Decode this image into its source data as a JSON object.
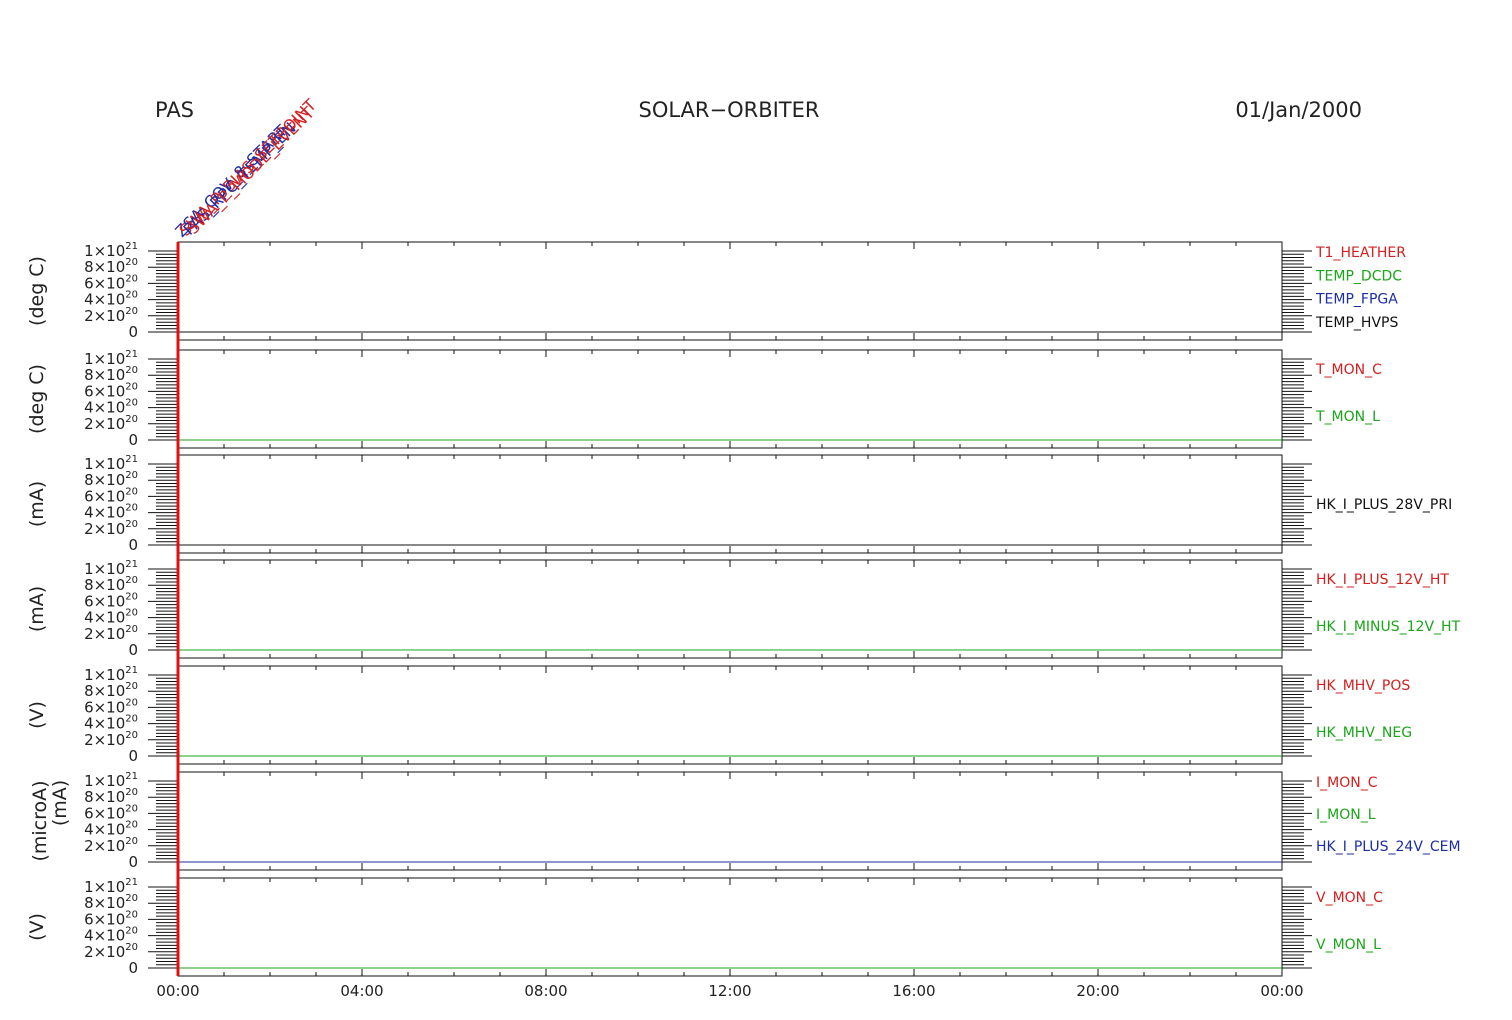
{
  "header": {
    "left": "PAS",
    "center": "SOLAR−ORBITER",
    "right": "01/Jan/2000"
  },
  "colors": {
    "red": "#d42020",
    "green": "#1aa51a",
    "blue": "#1c2ea6",
    "black": "#111111",
    "marker": "#e01010"
  },
  "chart_data": {
    "type": "line",
    "x_range": [
      "00:00",
      "24:00"
    ],
    "x_tick_labels": [
      "00:00",
      "04:00",
      "08:00",
      "12:00",
      "16:00",
      "20:00",
      "00:00"
    ],
    "marker_time": "00:00",
    "event_labels": [
      {
        "text": "ZSA_COV_8_START",
        "color": "blue"
      },
      {
        "text": "SWA_P_BIAS_SETPOINT",
        "color": "red"
      },
      {
        "text": "PAS_RPC_TEMP_EN",
        "color": "blue"
      },
      {
        "text": "SWA_P_MODE_EVENT",
        "color": "red"
      }
    ],
    "panels": [
      {
        "ylabel": "(deg C)",
        "ylim": [
          0,
          1e+21
        ],
        "y_ticks": [
          {
            "m": "0",
            "e": ""
          },
          {
            "m": "2×10",
            "e": "20"
          },
          {
            "m": "4×10",
            "e": "20"
          },
          {
            "m": "6×10",
            "e": "20"
          },
          {
            "m": "8×10",
            "e": "20"
          },
          {
            "m": "1×10",
            "e": "21"
          }
        ],
        "series": [
          {
            "name": "T1_HEATHER",
            "color": "red",
            "values": [
              0,
              0
            ]
          },
          {
            "name": "TEMP_DCDC",
            "color": "green",
            "values": [
              0,
              0
            ]
          },
          {
            "name": "TEMP_FPGA",
            "color": "blue",
            "values": [
              0,
              0
            ]
          },
          {
            "name": "TEMP_HVPS",
            "color": "black",
            "values": [
              0,
              0
            ]
          }
        ]
      },
      {
        "ylabel": "(deg C)",
        "ylim": [
          0,
          1e+21
        ],
        "y_ticks": [
          {
            "m": "0",
            "e": ""
          },
          {
            "m": "2×10",
            "e": "20"
          },
          {
            "m": "4×10",
            "e": "20"
          },
          {
            "m": "6×10",
            "e": "20"
          },
          {
            "m": "8×10",
            "e": "20"
          },
          {
            "m": "1×10",
            "e": "21"
          }
        ],
        "series": [
          {
            "name": "T_MON_C",
            "color": "red",
            "values": [
              0,
              0
            ]
          },
          {
            "name": "T_MON_L",
            "color": "green",
            "values": [
              0,
              0
            ]
          }
        ]
      },
      {
        "ylabel": "(mA)",
        "ylim": [
          0,
          1e+21
        ],
        "y_ticks": [
          {
            "m": "0",
            "e": ""
          },
          {
            "m": "2×10",
            "e": "20"
          },
          {
            "m": "4×10",
            "e": "20"
          },
          {
            "m": "6×10",
            "e": "20"
          },
          {
            "m": "8×10",
            "e": "20"
          },
          {
            "m": "1×10",
            "e": "21"
          }
        ],
        "series": [
          {
            "name": "HK_I_PLUS_28V_PRI",
            "color": "black",
            "values": [
              0,
              0
            ]
          }
        ]
      },
      {
        "ylabel": "(mA)",
        "ylim": [
          0,
          1e+21
        ],
        "y_ticks": [
          {
            "m": "0",
            "e": ""
          },
          {
            "m": "2×10",
            "e": "20"
          },
          {
            "m": "4×10",
            "e": "20"
          },
          {
            "m": "6×10",
            "e": "20"
          },
          {
            "m": "8×10",
            "e": "20"
          },
          {
            "m": "1×10",
            "e": "21"
          }
        ],
        "series": [
          {
            "name": "HK_I_PLUS_12V_HT",
            "color": "red",
            "values": [
              0,
              0
            ]
          },
          {
            "name": "HK_I_MINUS_12V_HT",
            "color": "green",
            "values": [
              0,
              0
            ]
          }
        ]
      },
      {
        "ylabel": "(V)",
        "ylim": [
          0,
          1e+21
        ],
        "y_ticks": [
          {
            "m": "0",
            "e": ""
          },
          {
            "m": "2×10",
            "e": "20"
          },
          {
            "m": "4×10",
            "e": "20"
          },
          {
            "m": "6×10",
            "e": "20"
          },
          {
            "m": "8×10",
            "e": "20"
          },
          {
            "m": "1×10",
            "e": "21"
          }
        ],
        "series": [
          {
            "name": "HK_MHV_POS",
            "color": "red",
            "values": [
              0,
              0
            ]
          },
          {
            "name": "HK_MHV_NEG",
            "color": "green",
            "values": [
              0,
              0
            ]
          }
        ]
      },
      {
        "ylabel": "(microA)",
        "ylabel2": "(mA)",
        "ylim": [
          0,
          1e+21
        ],
        "y_ticks": [
          {
            "m": "0",
            "e": ""
          },
          {
            "m": "2×10",
            "e": "20"
          },
          {
            "m": "4×10",
            "e": "20"
          },
          {
            "m": "6×10",
            "e": "20"
          },
          {
            "m": "8×10",
            "e": "20"
          },
          {
            "m": "1×10",
            "e": "21"
          }
        ],
        "series": [
          {
            "name": "I_MON_C",
            "color": "red",
            "values": [
              0,
              0
            ]
          },
          {
            "name": "I_MON_L",
            "color": "green",
            "values": [
              0,
              0
            ]
          },
          {
            "name": "HK_I_PLUS_24V_CEM",
            "color": "blue",
            "values": [
              0,
              0
            ]
          }
        ]
      },
      {
        "ylabel": "(V)",
        "ylim": [
          0,
          1e+21
        ],
        "y_ticks": [
          {
            "m": "0",
            "e": ""
          },
          {
            "m": "2×10",
            "e": "20"
          },
          {
            "m": "4×10",
            "e": "20"
          },
          {
            "m": "6×10",
            "e": "20"
          },
          {
            "m": "8×10",
            "e": "20"
          },
          {
            "m": "1×10",
            "e": "21"
          }
        ],
        "series": [
          {
            "name": "V_MON_C",
            "color": "red",
            "values": [
              0,
              0
            ]
          },
          {
            "name": "V_MON_L",
            "color": "green",
            "values": [
              0,
              0
            ]
          }
        ]
      }
    ]
  }
}
